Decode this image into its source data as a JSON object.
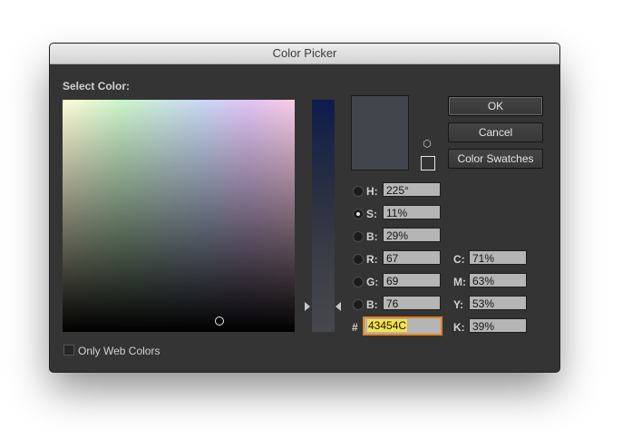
{
  "window": {
    "title": "Color Picker"
  },
  "select_color_label": "Select Color:",
  "only_web_colors_label": "Only Web Colors",
  "only_web_colors_checked": false,
  "current_color": "#43454C",
  "buttons": {
    "ok": "OK",
    "cancel": "Cancel",
    "swatches": "Color Swatches"
  },
  "hsb": {
    "h": {
      "label": "H:",
      "value": "225°"
    },
    "s": {
      "label": "S:",
      "value": "11%"
    },
    "b": {
      "label": "B:",
      "value": "29%"
    }
  },
  "rgb": {
    "r": {
      "label": "R:",
      "value": "67"
    },
    "g": {
      "label": "G:",
      "value": "69"
    },
    "b": {
      "label": "B:",
      "value": "76"
    }
  },
  "cmyk": {
    "c": {
      "label": "C:",
      "value": "71%"
    },
    "m": {
      "label": "M:",
      "value": "63%"
    },
    "y": {
      "label": "Y:",
      "value": "53%"
    },
    "k": {
      "label": "K:",
      "value": "39%"
    }
  },
  "hex": {
    "label": "#",
    "value": "43454C"
  },
  "selected_mode": "S"
}
